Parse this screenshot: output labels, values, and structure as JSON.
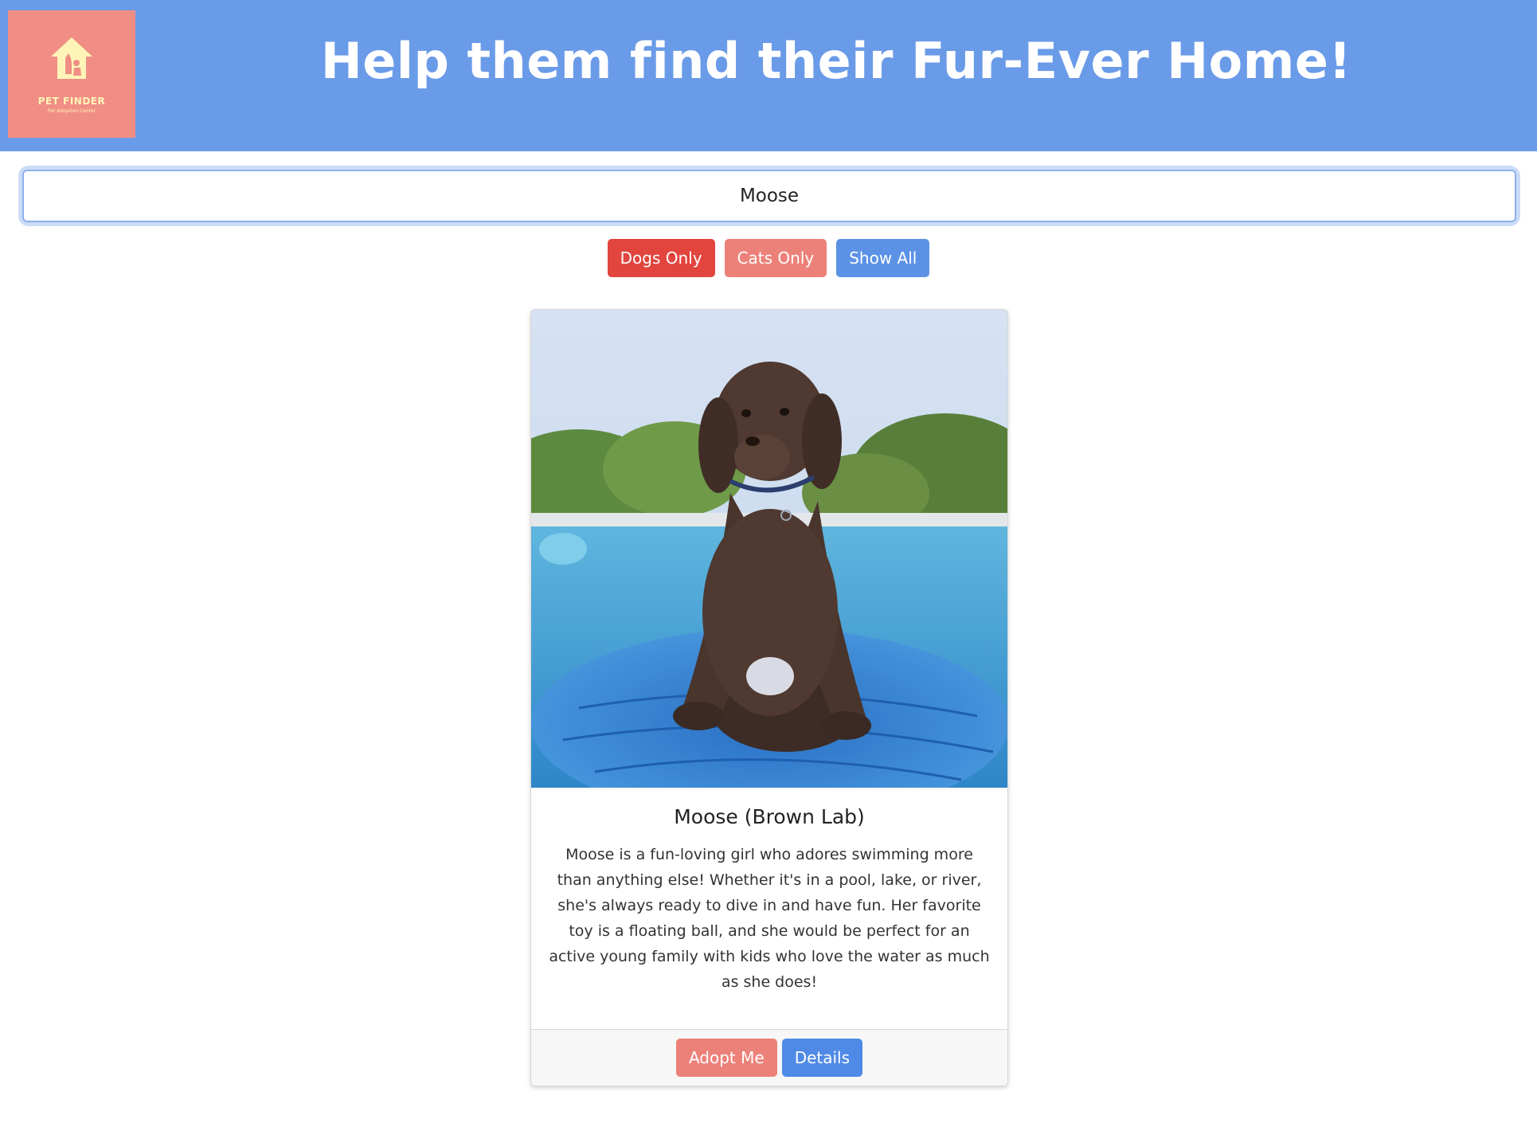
{
  "header": {
    "logo_title": "PET FINDER",
    "logo_subtitle": "Pet Adoption Center",
    "headline": "Help them find their Fur-Ever Home!"
  },
  "search": {
    "value": "Moose"
  },
  "filters": {
    "dogs_label": "Dogs Only",
    "cats_label": "Cats Only",
    "all_label": "Show All"
  },
  "card": {
    "title": "Moose (Brown Lab)",
    "description": "Moose is a fun-loving girl who adores swimming more than anything else! Whether it's in a pool, lake, or river, she's always ready to dive in and have fun. Her favorite toy is a floating ball, and she would be perfect for an active young family with kids who love the water as much as she does!",
    "adopt_label": "Adopt Me",
    "details_label": "Details"
  },
  "colors": {
    "header_bg": "#6a9be8",
    "logo_bg": "#f08e85",
    "dogs_button": "#e2453e",
    "cats_button": "#ec8179",
    "all_button": "#5b92e6"
  }
}
